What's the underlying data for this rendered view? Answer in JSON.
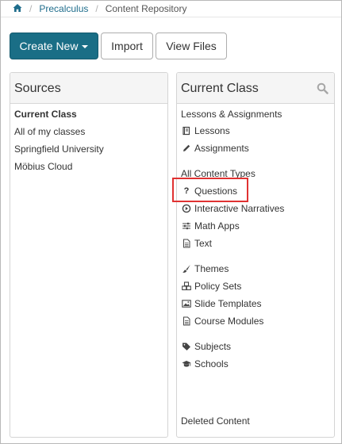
{
  "breadcrumb": {
    "home_icon": "home-icon",
    "items": [
      "Precalculus",
      "Content Repository"
    ]
  },
  "toolbar": {
    "create_new_label": "Create New",
    "import_label": "Import",
    "view_files_label": "View Files",
    "primary_color": "#1a6e86"
  },
  "sources": {
    "title": "Sources",
    "items": [
      "Current Class",
      "All of my classes",
      "Springfield University",
      "Möbius Cloud"
    ]
  },
  "current_class": {
    "title": "Current Class",
    "search_icon": "search-icon",
    "groups": [
      {
        "label": "Lessons & Assignments",
        "items": [
          {
            "label": "Lessons",
            "icon": "book-icon"
          },
          {
            "label": "Assignments",
            "icon": "pencil-icon"
          }
        ]
      },
      {
        "label": "All Content Types",
        "items": [
          {
            "label": "Questions",
            "icon": "question-icon"
          },
          {
            "label": "Interactive Narratives",
            "icon": "play-circle-icon"
          },
          {
            "label": "Math Apps",
            "icon": "sliders-icon"
          },
          {
            "label": "Text",
            "icon": "document-icon"
          }
        ]
      },
      {
        "label": "",
        "items": [
          {
            "label": "Themes",
            "icon": "brush-icon"
          },
          {
            "label": "Policy Sets",
            "icon": "cubes-icon"
          },
          {
            "label": "Slide Templates",
            "icon": "image-icon"
          },
          {
            "label": "Course Modules",
            "icon": "document-icon"
          }
        ]
      },
      {
        "label": "",
        "items": [
          {
            "label": "Subjects",
            "icon": "tag-icon"
          },
          {
            "label": "Schools",
            "icon": "graduation-cap-icon"
          }
        ]
      }
    ],
    "deleted_label": "Deleted Content",
    "highlight_color": "#e03232"
  }
}
